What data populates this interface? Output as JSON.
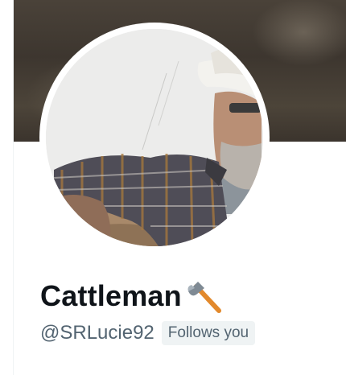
{
  "profile": {
    "display_name": "Cattleman",
    "name_emoji": "axe-icon",
    "handle": "@SRLucie92",
    "follows_badge": "Follows you"
  },
  "colors": {
    "name_text": "#0f1419",
    "secondary_text": "#536471",
    "badge_background": "#eff3f4",
    "banner_tone": "#453d35",
    "axe_handle": "#e2892c",
    "axe_head": "#7f8a94"
  }
}
